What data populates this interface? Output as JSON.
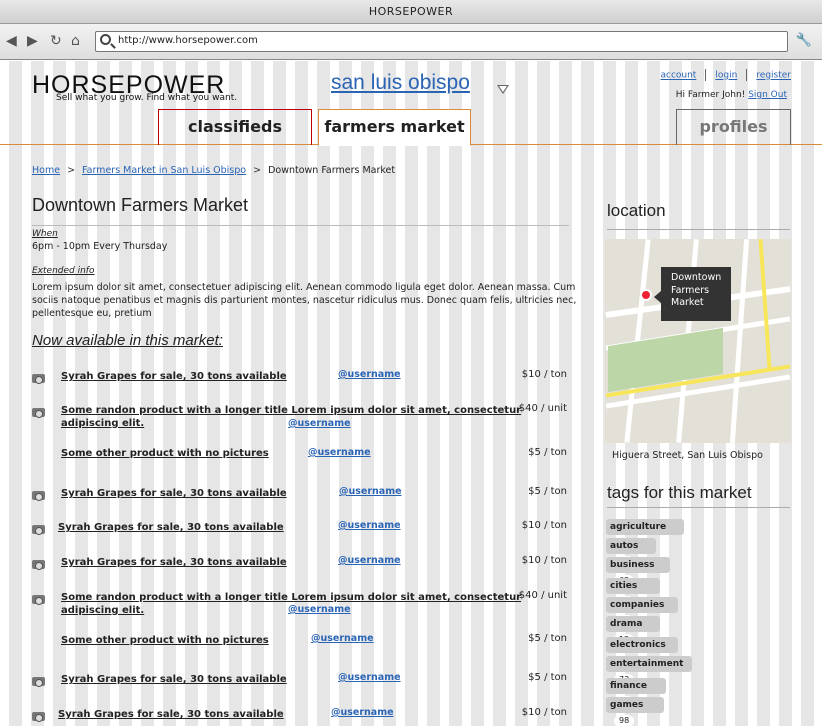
{
  "window": {
    "title": "HORSEPOWER"
  },
  "browser": {
    "url": "http://www.horsepower.com"
  },
  "site": {
    "logo": "HORSEPOWER",
    "tagline": "Sell what you grow. Find what you want.",
    "city": "san luis obispo",
    "links": {
      "account": "account",
      "login": "login",
      "register": "register"
    },
    "greeting": "Hi Farmer John!",
    "signout": "Sign Out"
  },
  "tabs": {
    "classifieds": "classifieds",
    "market": "farmers market",
    "profiles": "profiles"
  },
  "breadcrumb": {
    "home": "Home",
    "sep": ">",
    "parent": "Farmers Market in San Luis Obispo",
    "current": "Downtown Farmers Market"
  },
  "market": {
    "title": "Downtown Farmers Market",
    "when_label": "When",
    "when": "6pm - 10pm Every Thursday",
    "info_label": "Extended info",
    "info_1": "Lorem ipsum dolor sit amet, consectetuer adipiscing elit. Aenean commodo ligula eget dolor. Aenean massa. Cum",
    "info_2": "sociis natoque penatibus et magnis dis parturient montes, nascetur ridiculus mus. Donec quam felis, ultricies nec,",
    "info_3": "pellentesque eu, pretium",
    "available": "Now available in this market:"
  },
  "listings": [
    {
      "title": "Syrah Grapes for sale, 30 tons available",
      "user": "@username",
      "price": "$10 / ton"
    },
    {
      "title": "Some randon product with a longer title Lorem ipsum dolor sit amet, consectetur",
      "title2": "adipiscing elit.",
      "user": "@username",
      "price": "$40 / unit"
    },
    {
      "title": "Some other product with no pictures",
      "user": "@username",
      "price": "$5 / ton"
    },
    {
      "title": "Syrah Grapes for sale, 30 tons available",
      "user": "@username",
      "price": "$5 / ton"
    },
    {
      "title": "Syrah Grapes for sale, 30 tons available",
      "user": "@username",
      "price": "$10 / ton"
    },
    {
      "title": "Syrah Grapes for sale, 30 tons available",
      "user": "@username",
      "price": "$10 / ton"
    },
    {
      "title": "Some randon product with a longer title Lorem ipsum dolor sit amet, consectetur",
      "title2": "adipiscing elit.",
      "user": "@username",
      "price": "$40 / unit"
    },
    {
      "title": "Some other product with no pictures",
      "user": "@username",
      "price": "$5 / ton"
    },
    {
      "title": "Syrah Grapes for sale, 30 tons available",
      "user": "@username",
      "price": "$5 / ton"
    },
    {
      "title": "Syrah Grapes for sale, 30 tons available",
      "user": "@username",
      "price": "$10 / ton"
    }
  ],
  "location": {
    "heading": "location",
    "tip_1": "Downtown",
    "tip_2": "Farmers",
    "tip_3": "Market",
    "address": "Higuera Street, San Luis Obispo"
  },
  "tags": {
    "heading": "tags for this market",
    "items": [
      {
        "name": "agriculture",
        "count": "7"
      },
      {
        "name": "autos",
        "count": "81"
      },
      {
        "name": "business",
        "count": "62"
      },
      {
        "name": "cities",
        "count": "21"
      },
      {
        "name": "companies",
        "count": "34"
      },
      {
        "name": "drama",
        "count": "12"
      },
      {
        "name": "electronics",
        "count": "9"
      },
      {
        "name": "entertainment",
        "count": "73"
      },
      {
        "name": "finance",
        "count": "16"
      },
      {
        "name": "games",
        "count": "98"
      }
    ]
  },
  "icons": {
    "back": "back-arrow-icon",
    "forward": "forward-arrow-icon",
    "reload": "reload-icon",
    "home": "home-icon",
    "search": "search-icon",
    "wrench": "wrench-icon",
    "camera": "camera-icon",
    "dropdown": "triangle-down-icon",
    "pin": "map-pin-icon"
  }
}
